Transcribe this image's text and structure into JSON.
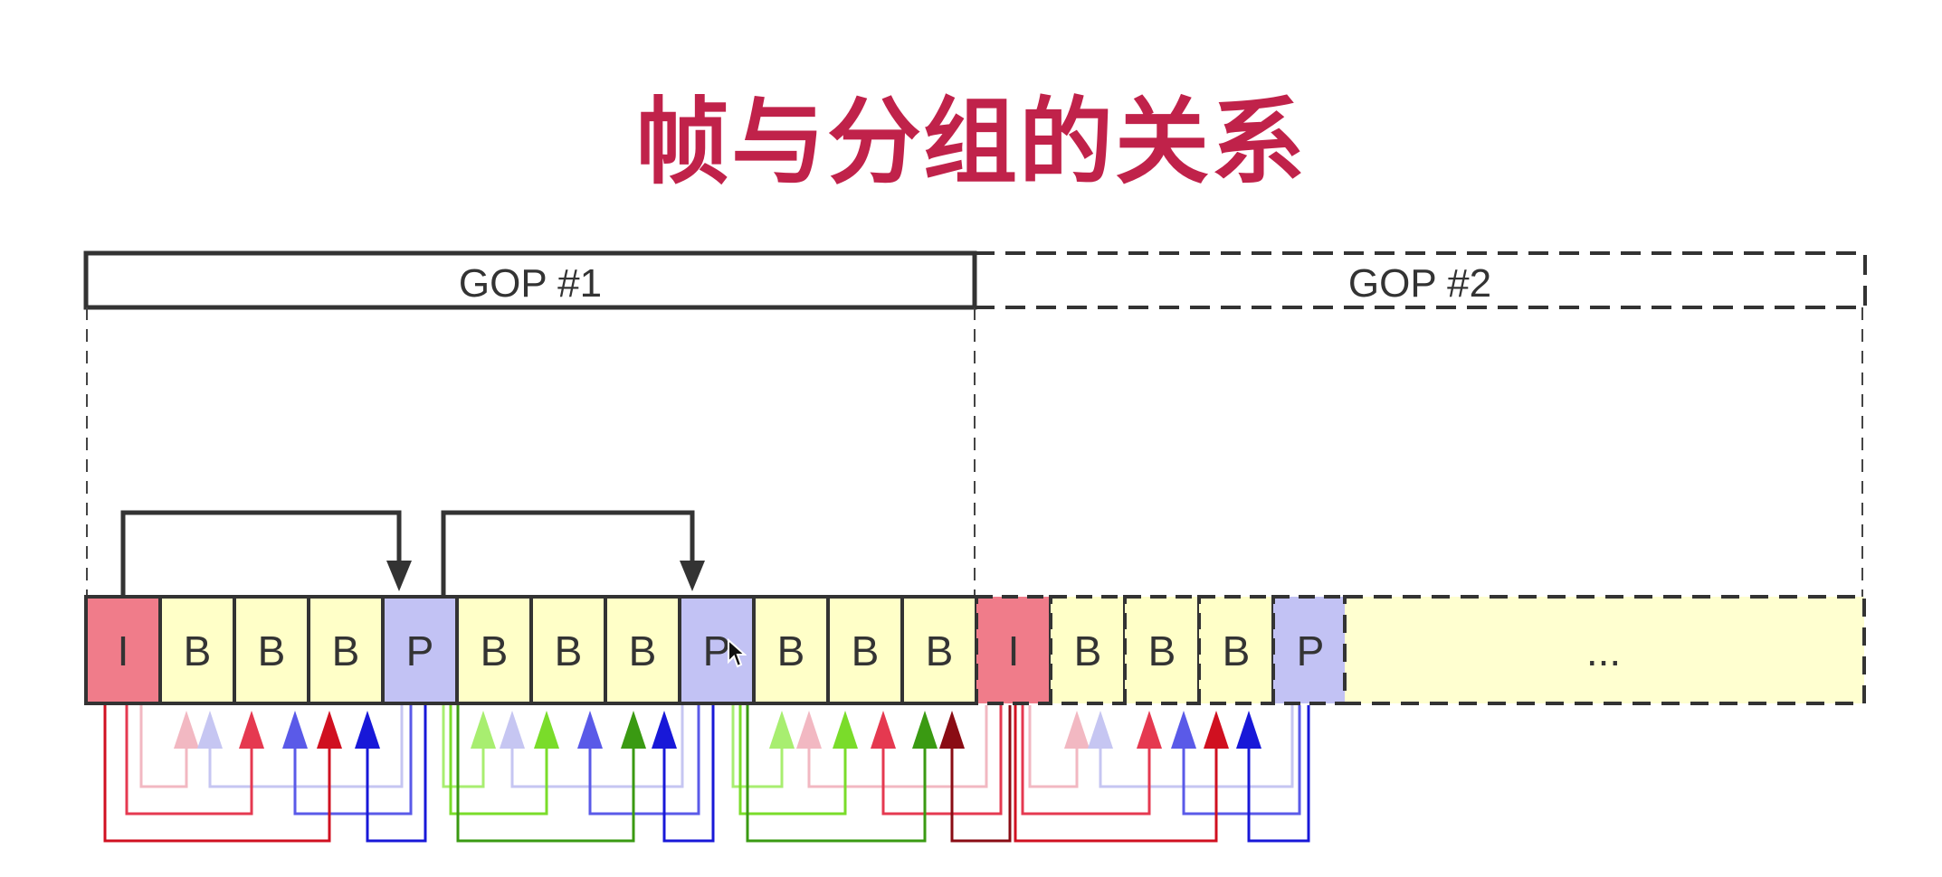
{
  "title": "帧与分组的关系",
  "gops": [
    {
      "label": "GOP #1",
      "style": "solid"
    },
    {
      "label": "GOP #2",
      "style": "dashed"
    }
  ],
  "frames": [
    "I",
    "B",
    "B",
    "B",
    "P",
    "B",
    "B",
    "B",
    "P",
    "B",
    "B",
    "B",
    "I",
    "B",
    "B",
    "B",
    "P"
  ],
  "ellipsis": "...",
  "colors": {
    "title": "#c0224a",
    "I_frame": "#f07c8a",
    "B_frame": "#ffffc8",
    "P_frame": "#c2c2f4",
    "reference_arrow": "#333333"
  }
}
